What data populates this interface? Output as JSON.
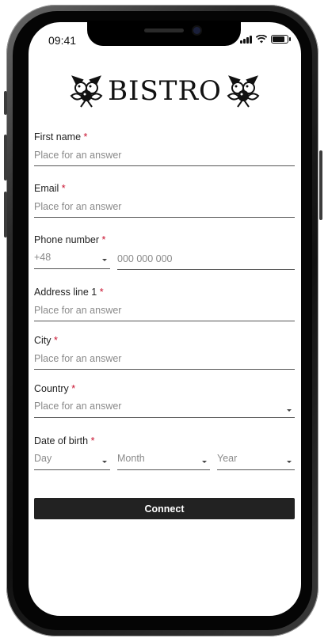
{
  "status": {
    "time": "09:41"
  },
  "brand": {
    "name": "BISTRO",
    "logo_icon": "berries-ornament-icon"
  },
  "form": {
    "first_name": {
      "label": "First name",
      "required": "*",
      "placeholder": "Place for an answer"
    },
    "email": {
      "label": "Email",
      "required": "*",
      "placeholder": "Place for an answer"
    },
    "phone": {
      "label": "Phone number",
      "required": "*",
      "country_code": "+48",
      "placeholder": "000 000 000"
    },
    "address": {
      "label": "Address line 1",
      "required": "*",
      "placeholder": "Place for an answer"
    },
    "city": {
      "label": "City",
      "required": "*",
      "placeholder": "Place for an answer"
    },
    "country": {
      "label": "Country",
      "required": "*",
      "placeholder": "Place for an answer"
    },
    "dob": {
      "label": "Date of birth",
      "required": "*",
      "day": "Day",
      "month": "Month",
      "year": "Year"
    },
    "submit_label": "Connect"
  },
  "colors": {
    "required": "#c8102e",
    "button_bg": "#222222",
    "underline": "#555555"
  }
}
